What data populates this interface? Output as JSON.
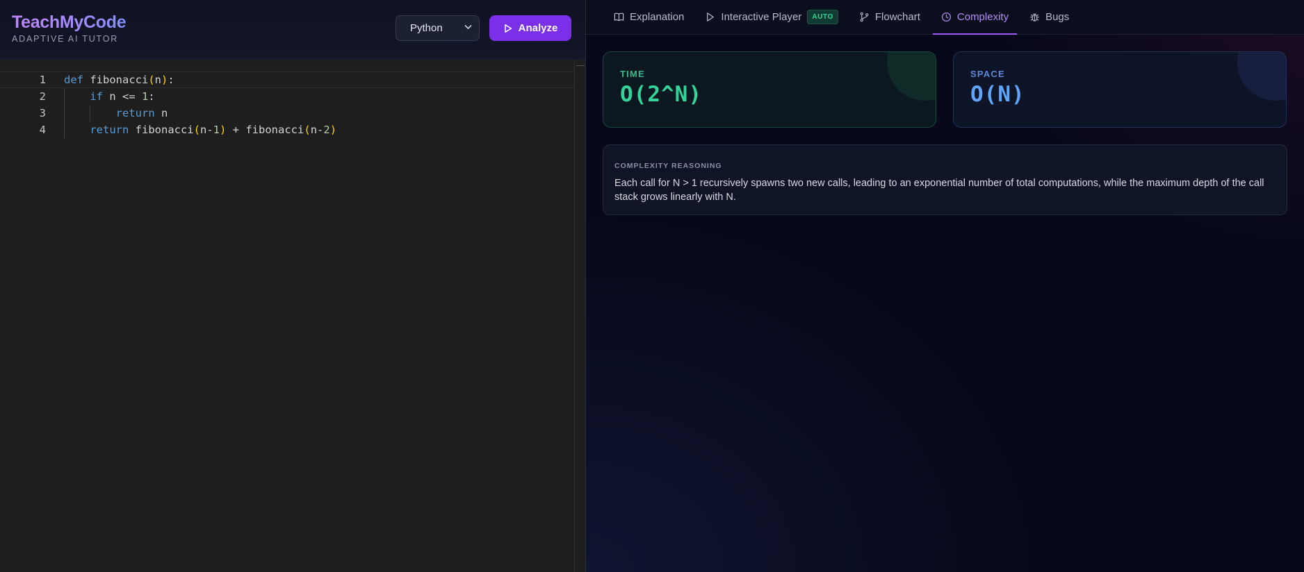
{
  "brand": {
    "title": "TeachMyCode",
    "subtitle": "ADAPTIVE AI TUTOR"
  },
  "toolbar": {
    "language": "Python",
    "analyze_label": "Analyze"
  },
  "editor": {
    "line_numbers": [
      "1",
      "2",
      "3",
      "4"
    ],
    "lines": [
      "def fibonacci(n):",
      "    if n <= 1:",
      "        return n",
      "    return fibonacci(n-1) + fibonacci(n-2)"
    ]
  },
  "tabs": [
    {
      "label": "Explanation",
      "icon": "book-icon"
    },
    {
      "label": "Interactive Player",
      "icon": "play-icon",
      "badge": "AUTO"
    },
    {
      "label": "Flowchart",
      "icon": "git-branch-icon"
    },
    {
      "label": "Complexity",
      "icon": "clock-icon",
      "active": true
    },
    {
      "label": "Bugs",
      "icon": "bug-icon"
    }
  ],
  "complexity": {
    "time_label": "TIME",
    "time_value": "O(2^N)",
    "space_label": "SPACE",
    "space_value": "O(N)",
    "reasoning_label": "COMPLEXITY REASONING",
    "reasoning_text": "Each call for N > 1 recursively spawns two new calls, leading to an exponential number of total computations, while the maximum depth of the call stack grows linearly with N."
  },
  "colors": {
    "accent": "#7c2fe8",
    "active_tab": "#b58cf8",
    "time": "#34d399",
    "space": "#60a5fa"
  }
}
